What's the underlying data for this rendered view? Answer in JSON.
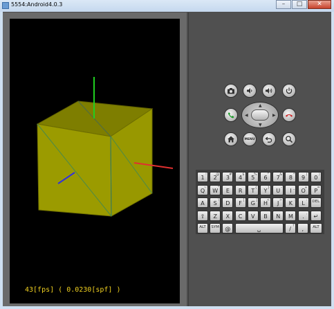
{
  "window": {
    "title": "5554:Android4.0.3",
    "buttons": [
      "–",
      "□",
      "✕"
    ]
  },
  "app": {
    "status_text": "43[fps] ( 0.0230[spf] )"
  },
  "scene_colors": {
    "cube_face": "#9b9b00",
    "cube_top": "#7e7e00",
    "axis_x": "#e03030",
    "axis_y": "#20d020",
    "axis_z": "#3030e0"
  },
  "controls": {
    "camera": "camera-icon",
    "volume_down": "volume-down-icon",
    "volume_up": "volume-up-icon",
    "power": "power-icon",
    "call": "call-icon",
    "end_call": "end-call-icon",
    "home": "home-icon",
    "menu": "MENU",
    "back": "back-icon",
    "search": "search-icon"
  },
  "keyboard": {
    "row1": [
      {
        "main": "1",
        "alt": "!"
      },
      {
        "main": "2",
        "alt": "@"
      },
      {
        "main": "3",
        "alt": "#"
      },
      {
        "main": "4",
        "alt": "$"
      },
      {
        "main": "5",
        "alt": "%"
      },
      {
        "main": "6",
        "alt": "^"
      },
      {
        "main": "7",
        "alt": "&"
      },
      {
        "main": "8",
        "alt": "*"
      },
      {
        "main": "9",
        "alt": "("
      },
      {
        "main": "0",
        "alt": ")"
      }
    ],
    "row2": [
      {
        "main": "Q",
        "alt": "~"
      },
      {
        "main": "W",
        "alt": "\""
      },
      {
        "main": "E",
        "alt": "´"
      },
      {
        "main": "R",
        "alt": ""
      },
      {
        "main": "T",
        "alt": "{"
      },
      {
        "main": "Y",
        "alt": "}"
      },
      {
        "main": "U",
        "alt": "-"
      },
      {
        "main": "I",
        "alt": "_"
      },
      {
        "main": "O",
        "alt": "+"
      },
      {
        "main": "P",
        "alt": "="
      }
    ],
    "row3": [
      {
        "main": "A",
        "alt": ""
      },
      {
        "main": "S",
        "alt": "\\"
      },
      {
        "main": "D",
        "alt": ""
      },
      {
        "main": "F",
        "alt": "["
      },
      {
        "main": "G",
        "alt": "]"
      },
      {
        "main": "H",
        "alt": "<"
      },
      {
        "main": "J",
        "alt": ">"
      },
      {
        "main": "K",
        "alt": ";"
      },
      {
        "main": "L",
        "alt": ":"
      },
      {
        "main": "DEL",
        "alt": ""
      }
    ],
    "row4": [
      {
        "main": "⇧",
        "alt": ""
      },
      {
        "main": "Z",
        "alt": ""
      },
      {
        "main": "X",
        "alt": ""
      },
      {
        "main": "C",
        "alt": ""
      },
      {
        "main": "V",
        "alt": ""
      },
      {
        "main": "B",
        "alt": ""
      },
      {
        "main": "N",
        "alt": ""
      },
      {
        "main": "M",
        "alt": ""
      },
      {
        "main": ".",
        "alt": ","
      },
      {
        "main": "↵",
        "alt": ""
      }
    ],
    "row5": [
      {
        "main": "ALT",
        "alt": ""
      },
      {
        "main": "SYM",
        "alt": ""
      },
      {
        "main": "@",
        "alt": ""
      },
      {
        "main": "␣",
        "alt": ""
      },
      {
        "main": "/",
        "alt": "?"
      },
      {
        "main": ",",
        "alt": ""
      },
      {
        "main": "ALT",
        "alt": ""
      }
    ]
  }
}
